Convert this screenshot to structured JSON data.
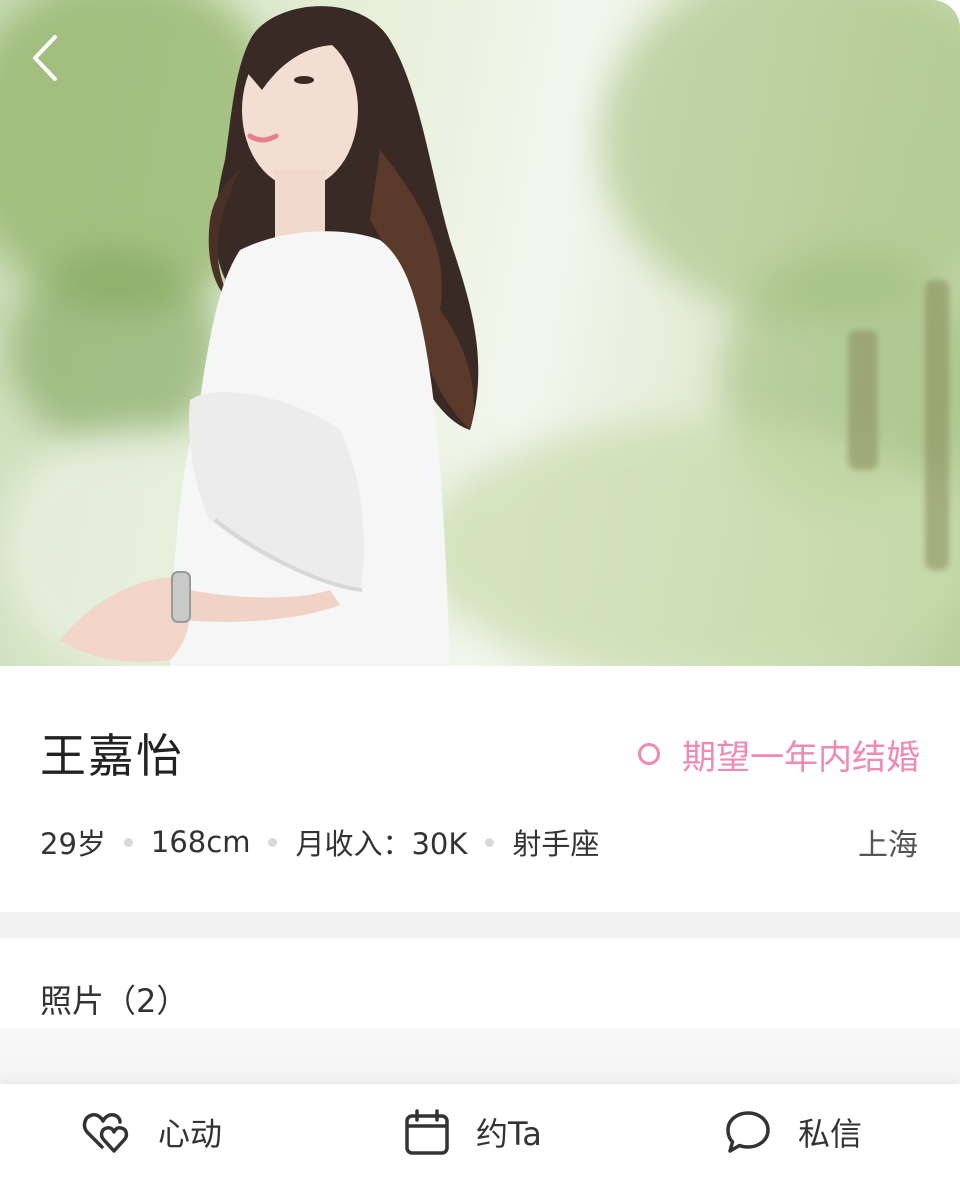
{
  "profile": {
    "name": "王嘉怡",
    "goal": "期望一年内结婚",
    "stats": {
      "age": "29岁",
      "height": "168cm",
      "income": "月收入：30K",
      "zodiac": "射手座"
    },
    "city": "上海"
  },
  "photos": {
    "title": "照片（2）"
  },
  "actions": {
    "heart": "心动",
    "date": "约Ta",
    "message": "私信"
  },
  "colors": {
    "accent_pink": "#f089b3",
    "text": "#333333",
    "separator": "#f2f2f2"
  },
  "icons": {
    "back": "chevron-left-icon",
    "goal": "ring-icon",
    "heart": "double-heart-icon",
    "date": "calendar-icon",
    "message": "chat-bubble-icon"
  }
}
